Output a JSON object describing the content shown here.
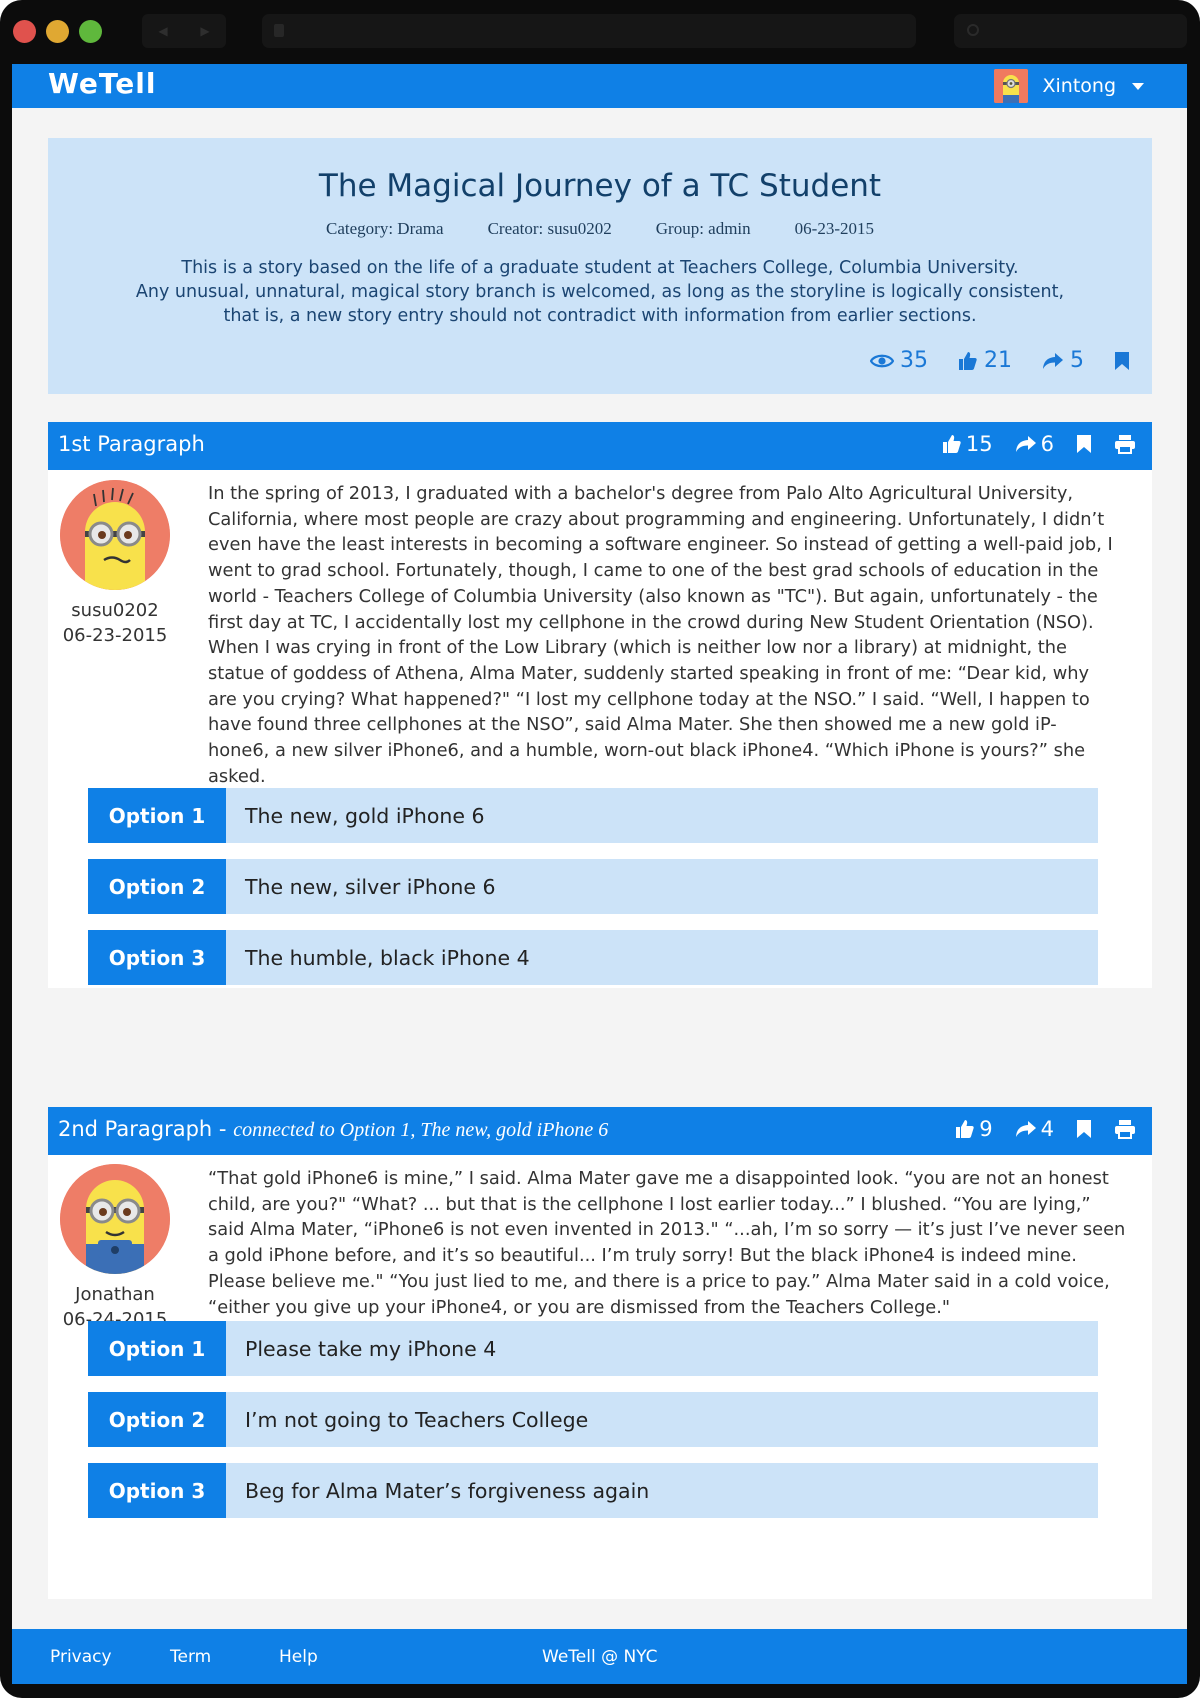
{
  "app": {
    "brand": "WeTell"
  },
  "user": {
    "name": "Xintong"
  },
  "story": {
    "title": "The Magical Journey of a TC Student",
    "category": "Category: Drama",
    "creator": "Creator: susu0202",
    "group": "Group: admin",
    "date": "06-23-2015",
    "description_lines": [
      "This is a story based on the life of a graduate student at Teachers College, Columbia University.",
      "Any unusual, unnatural, magical story branch is welcomed, as long as the storyline is logically consistent,",
      "that is, a new story entry should not contradict with information from earlier sections."
    ],
    "views": "35",
    "likes": "21",
    "shares": "5"
  },
  "paragraphs": [
    {
      "title": "1st Paragraph",
      "likes": "15",
      "shares": "6",
      "author": "susu0202",
      "date": "06-23-2015",
      "lines": [
        "In the spring of 2013, I graduated with a bachelor's degree from Palo Alto Agricultural University,",
        "California, where most people are crazy about programming and engineering. Unfortunately, I didn’t",
        "even have the least interests in becoming a software engineer. So instead of getting a well-paid job, I",
        "went to grad school. Fortunately, though, I came to one of the best grad schools of education in the",
        "world - Teachers College of Columbia University (also known as \"TC\"). But again, unfortunately - the",
        "first day at TC, I accidentally lost my cellphone in the crowd during New Student Orientation (NSO).",
        "When I was crying in front of the Low Library (which is neither low nor a library) at midnight, the",
        "statue of goddess of Athena, Alma Mater, suddenly started speaking in front of me: “Dear kid, why",
        "are you crying? What happened?\" “I lost my cellphone today at the NSO.” I said. “Well, I happen to",
        "have found three cellphones at the NSO”, said Alma Mater. She then showed me a new gold iP-",
        "hone6, a new silver iPhone6, and a humble, worn-out black iPhone4. “Which iPhone is yours?” she",
        "asked."
      ],
      "options": [
        {
          "label": "Option 1",
          "text": "The new, gold iPhone 6"
        },
        {
          "label": "Option 2",
          "text": "The new, silver iPhone 6"
        },
        {
          "label": "Option 3",
          "text": "The humble, black iPhone 4"
        }
      ]
    },
    {
      "title": "2nd Paragraph",
      "connector": " - ",
      "connection": "connected to Option 1, The new, gold iPhone 6",
      "likes": "9",
      "shares": "4",
      "author": "Jonathan",
      "date": "06-24-2015",
      "lines": [
        "“That gold iPhone6 is mine,” I said. Alma Mater gave me a disappointed look. “you are not an honest",
        "child, are you?\" “What? ... but that is the cellphone I lost earlier today...” I blushed. “You are lying,”",
        "said Alma Mater, “iPhone6 is not even invented in 2013.\" “...ah, I’m so sorry — it’s just I’ve never seen",
        "a gold iPhone before, and it’s so beautiful... I’m truly sorry! But the black iPhone4 is indeed mine.",
        "Please believe me.\" “You just lied to me, and there is a price to pay.” Alma Mater said in a cold voice,",
        "“either you give up your iPhone4, or you are dismissed from the Teachers College.\""
      ],
      "options": [
        {
          "label": "Option 1",
          "text": "Please take my iPhone 4"
        },
        {
          "label": "Option 2",
          "text": "I’m not going to Teachers College"
        },
        {
          "label": "Option 3",
          "text": "Beg for Alma Mater’s forgiveness again"
        }
      ]
    }
  ],
  "footer": {
    "privacy": "Privacy",
    "term": "Term",
    "help": "Help",
    "copyright": "WeTell @ NYC"
  },
  "colors": {
    "primary": "#0f80e6",
    "light": "#cce3f8",
    "header_text": "#12406a",
    "avatar_bg": "#ee7d67",
    "minion_yellow": "#f8e14b"
  },
  "icons": {
    "views": "eye-icon",
    "likes": "thumbs-up-icon",
    "shares": "share-icon",
    "bookmark": "bookmark-icon",
    "print": "print-icon"
  }
}
